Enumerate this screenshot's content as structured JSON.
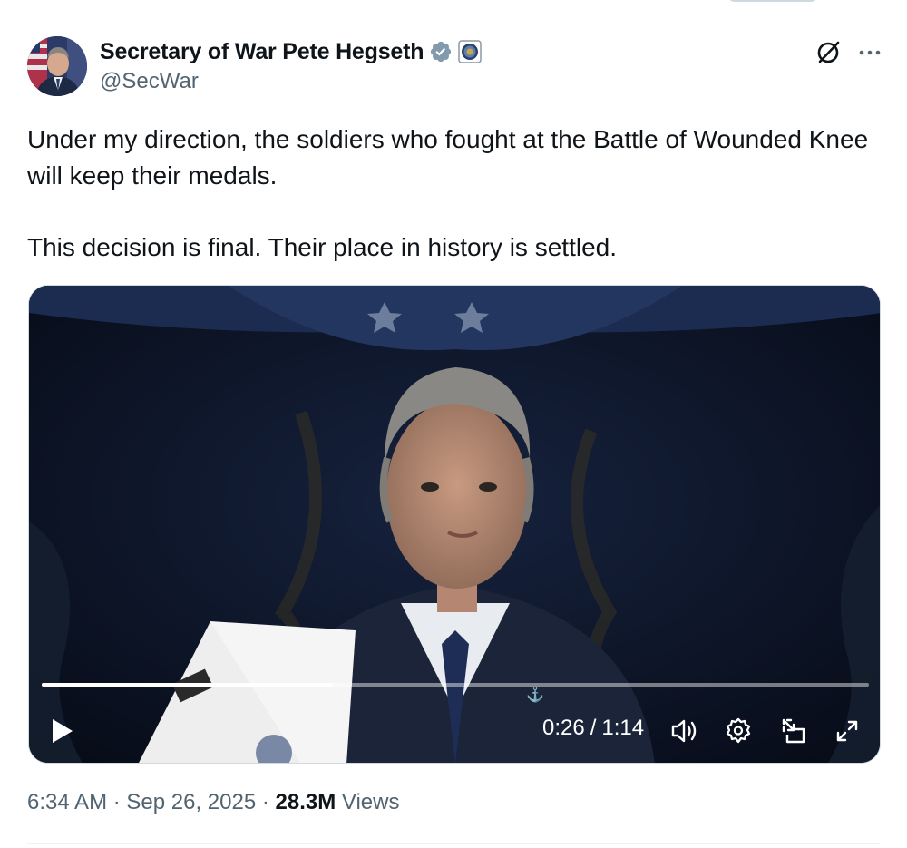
{
  "author": {
    "display_name": "Secretary of War Pete Hegseth",
    "handle": "@SecWar",
    "verified_icon": "verified-badge-icon",
    "affiliate_icon": "department-seal-icon",
    "avatar": "profile-avatar"
  },
  "actions": {
    "grok_icon": "grok-icon",
    "more_icon": "more-options-icon"
  },
  "tweet": {
    "paragraph_1": "Under my direction, the soldiers who fought at the Battle of Wounded Knee will keep their medals.",
    "paragraph_2": "This decision is final. Their place in history is settled."
  },
  "video": {
    "current_time": "0:26",
    "separator": "/",
    "duration": "1:14",
    "progress_fraction": 0.3514,
    "controls": [
      "play-icon",
      "volume-icon",
      "settings-icon",
      "picture-in-picture-icon",
      "fullscreen-icon"
    ]
  },
  "meta": {
    "time": "6:34 AM",
    "dot1": " · ",
    "date": "Sep 26, 2025",
    "dot2": " · ",
    "views_count": "28.3M",
    "views_label": " Views"
  },
  "colors": {
    "text_primary": "#0f1419",
    "text_secondary": "#536471",
    "verified_blue": "#829aab",
    "border": "#cfd9de"
  }
}
